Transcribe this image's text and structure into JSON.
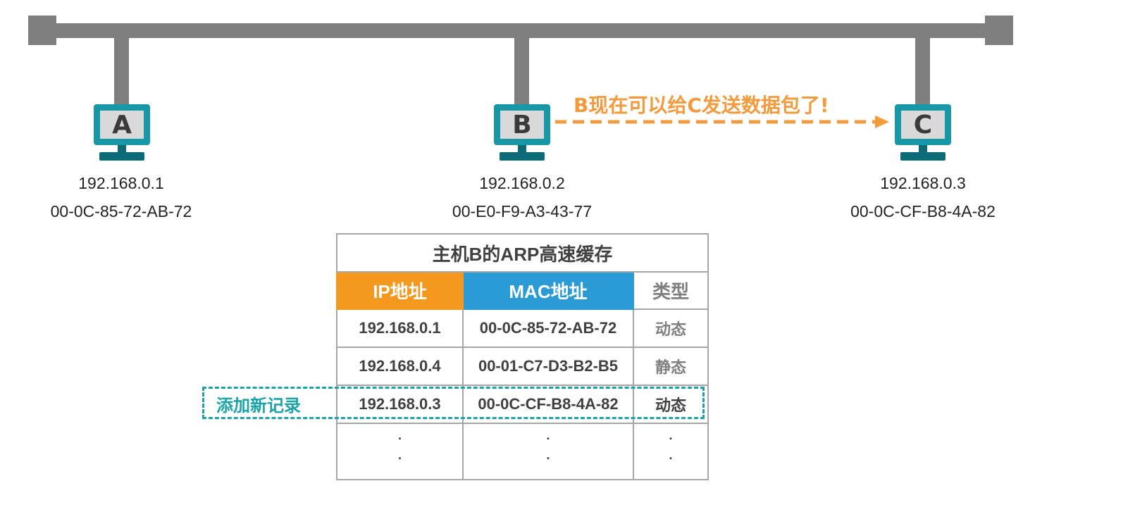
{
  "hosts": [
    {
      "label": "A",
      "ip": "192.168.0.1",
      "mac": "00-0C-85-72-AB-72"
    },
    {
      "label": "B",
      "ip": "192.168.0.2",
      "mac": "00-E0-F9-A3-43-77"
    },
    {
      "label": "C",
      "ip": "192.168.0.3",
      "mac": "00-0C-CF-B8-4A-82"
    }
  ],
  "arrow_text": "B现在可以给C发送数据包了!",
  "arp_table": {
    "title": "主机B的ARP高速缓存",
    "headers": {
      "ip": "IP地址",
      "mac": "MAC地址",
      "type": "类型"
    },
    "rows": [
      {
        "ip": "192.168.0.1",
        "mac": "00-0C-85-72-AB-72",
        "type": "动态"
      },
      {
        "ip": "192.168.0.4",
        "mac": "00-01-C7-D3-B2-B5",
        "type": "静态"
      },
      {
        "ip": "192.168.0.3",
        "mac": "00-0C-CF-B8-4A-82",
        "type": "动态"
      }
    ],
    "ellipsis": ".\n."
  },
  "new_record_label": "添加新记录",
  "colors": {
    "bus": "#7f7f7f",
    "monitor": "#1897a6",
    "arrow": "#f39b3c",
    "ip_header": "#f5981e",
    "mac_header": "#2b9bd6",
    "highlight": "#1aa3a8"
  }
}
